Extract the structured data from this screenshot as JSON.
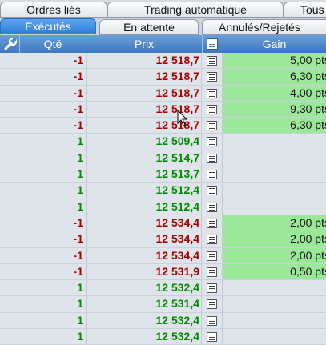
{
  "tabs_top": [
    "Ordres liés",
    "Trading automatique",
    "Tous"
  ],
  "tabs_bottom": [
    "Exécutés",
    "En attente",
    "Annulés/Rejetés"
  ],
  "columns": {
    "qty": "Qté",
    "prix": "Prix",
    "gain": "Gain"
  },
  "colors": {
    "header_blue": "#3d78c2",
    "gain_green": "#9ce89a",
    "sell_red": "#a00000",
    "buy_green": "#008a00"
  },
  "rows": [
    {
      "qty": "-1",
      "prix": "12 518,7",
      "gain": "5,00 pts"
    },
    {
      "qty": "-1",
      "prix": "12 518,7",
      "gain": "6,30 pts"
    },
    {
      "qty": "-1",
      "prix": "12 518,7",
      "gain": "4,00 pts"
    },
    {
      "qty": "-1",
      "prix": "12 518,7",
      "gain": "9,30 pts"
    },
    {
      "qty": "-1",
      "prix": "12 518,7",
      "gain": "6,30 pts"
    },
    {
      "qty": "1",
      "prix": "12 509,4",
      "gain": ""
    },
    {
      "qty": "1",
      "prix": "12 514,7",
      "gain": ""
    },
    {
      "qty": "1",
      "prix": "12 513,7",
      "gain": ""
    },
    {
      "qty": "1",
      "prix": "12 512,4",
      "gain": ""
    },
    {
      "qty": "1",
      "prix": "12 512,4",
      "gain": ""
    },
    {
      "qty": "-1",
      "prix": "12 534,4",
      "gain": "2,00 pts"
    },
    {
      "qty": "-1",
      "prix": "12 534,4",
      "gain": "2,00 pts"
    },
    {
      "qty": "-1",
      "prix": "12 534,4",
      "gain": "2,00 pts"
    },
    {
      "qty": "-1",
      "prix": "12 531,9",
      "gain": "0,50 pts"
    },
    {
      "qty": "1",
      "prix": "12 532,4",
      "gain": ""
    },
    {
      "qty": "1",
      "prix": "12 531,4",
      "gain": ""
    },
    {
      "qty": "1",
      "prix": "12 532,4",
      "gain": ""
    },
    {
      "qty": "1",
      "prix": "12 532,4",
      "gain": ""
    }
  ]
}
